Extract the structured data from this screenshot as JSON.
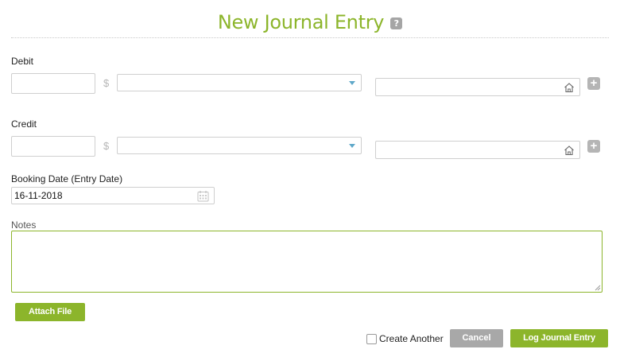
{
  "header": {
    "title": "New Journal Entry",
    "help_icon": "question-mark-icon",
    "help_label": "?"
  },
  "debit": {
    "label": "Debit",
    "amount_value": "",
    "currency_symbol": "$",
    "account_value": "",
    "location_value": "",
    "add_label": "+"
  },
  "credit": {
    "label": "Credit",
    "amount_value": "",
    "currency_symbol": "$",
    "account_value": "",
    "location_value": "",
    "add_label": "+"
  },
  "booking_date": {
    "label": "Booking Date (Entry Date)",
    "value": "16-11-2018"
  },
  "notes": {
    "label": "Notes",
    "value": ""
  },
  "attach": {
    "label": "Attach File"
  },
  "footer": {
    "create_another_label": "Create Another",
    "create_another_checked": false,
    "cancel_label": "Cancel",
    "submit_label": "Log Journal Entry"
  },
  "colors": {
    "brand_green": "#8cb52b",
    "button_grey": "#a8a8a8",
    "caret_blue": "#5fa8c9"
  }
}
